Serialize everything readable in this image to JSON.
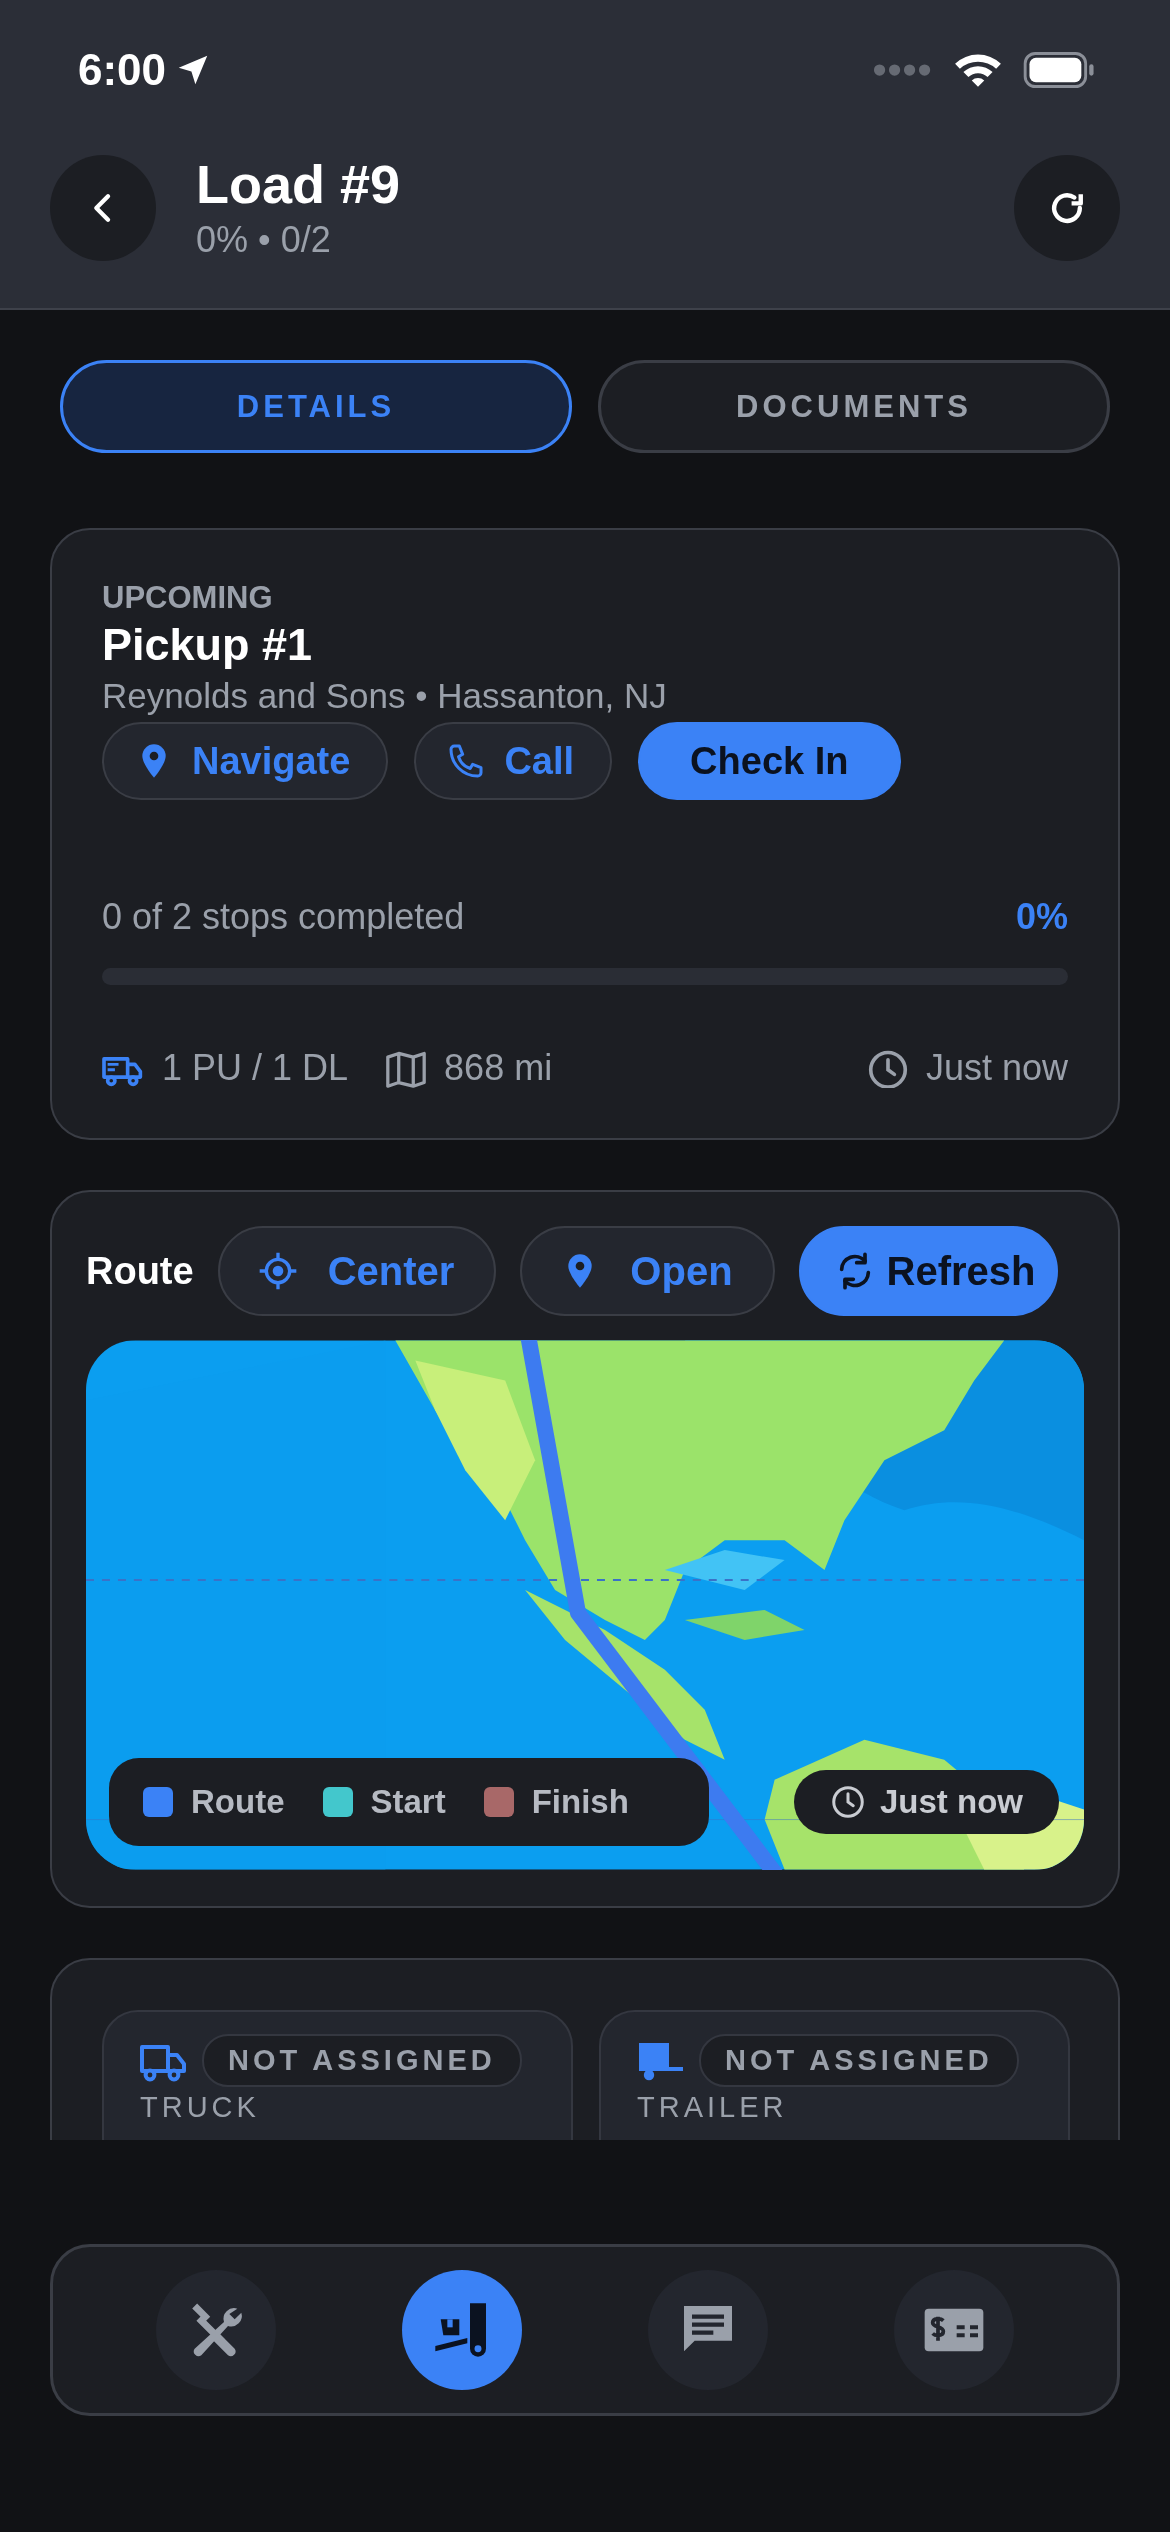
{
  "status_bar": {
    "time": "6:00"
  },
  "header": {
    "title": "Load #9",
    "subtitle": "0% • 0/2"
  },
  "tabs": [
    {
      "label": "DETAILS",
      "selected": true
    },
    {
      "label": "DOCUMENTS",
      "selected": false
    }
  ],
  "stop_card": {
    "status": "UPCOMING",
    "title": "Pickup #1",
    "address": "Reynolds and Sons • Hassanton, NJ",
    "actions": [
      {
        "kind": "navigate",
        "label": "Navigate",
        "primary": false
      },
      {
        "kind": "call",
        "label": "Call",
        "primary": false
      },
      {
        "kind": "check_in",
        "label": "Check In",
        "primary": true
      }
    ],
    "progress": {
      "text": "0 of 2 stops completed",
      "percent": "0%",
      "level": 0
    },
    "stats": [
      {
        "kind": "truck",
        "text": "1 PU / 1 DL"
      },
      {
        "kind": "map",
        "text": "868 mi"
      },
      {
        "kind": "clock",
        "text": "Just now"
      }
    ]
  },
  "route": {
    "title": "Route",
    "actions": [
      {
        "kind": "center",
        "label": "Center",
        "primary": false
      },
      {
        "kind": "open",
        "label": "Open",
        "primary": false
      },
      {
        "kind": "refresh",
        "label": "Refresh",
        "primary": true
      }
    ],
    "legend": [
      {
        "label": "Route",
        "color": "#3b82f6"
      },
      {
        "label": "Start",
        "color": "#43c7cc"
      },
      {
        "label": "Finish",
        "color": "#a86868"
      }
    ],
    "updated": "Just now"
  },
  "equipment": [
    {
      "kind": "truck",
      "status": "NOT ASSIGNED",
      "label": "TRUCK"
    },
    {
      "kind": "trailer",
      "status": "NOT ASSIGNED",
      "label": "TRAILER"
    }
  ],
  "bottom_nav": [
    {
      "kind": "tools",
      "selected": false
    },
    {
      "kind": "load",
      "selected": true
    },
    {
      "kind": "chat",
      "selected": false
    },
    {
      "kind": "pay",
      "selected": false
    }
  ]
}
